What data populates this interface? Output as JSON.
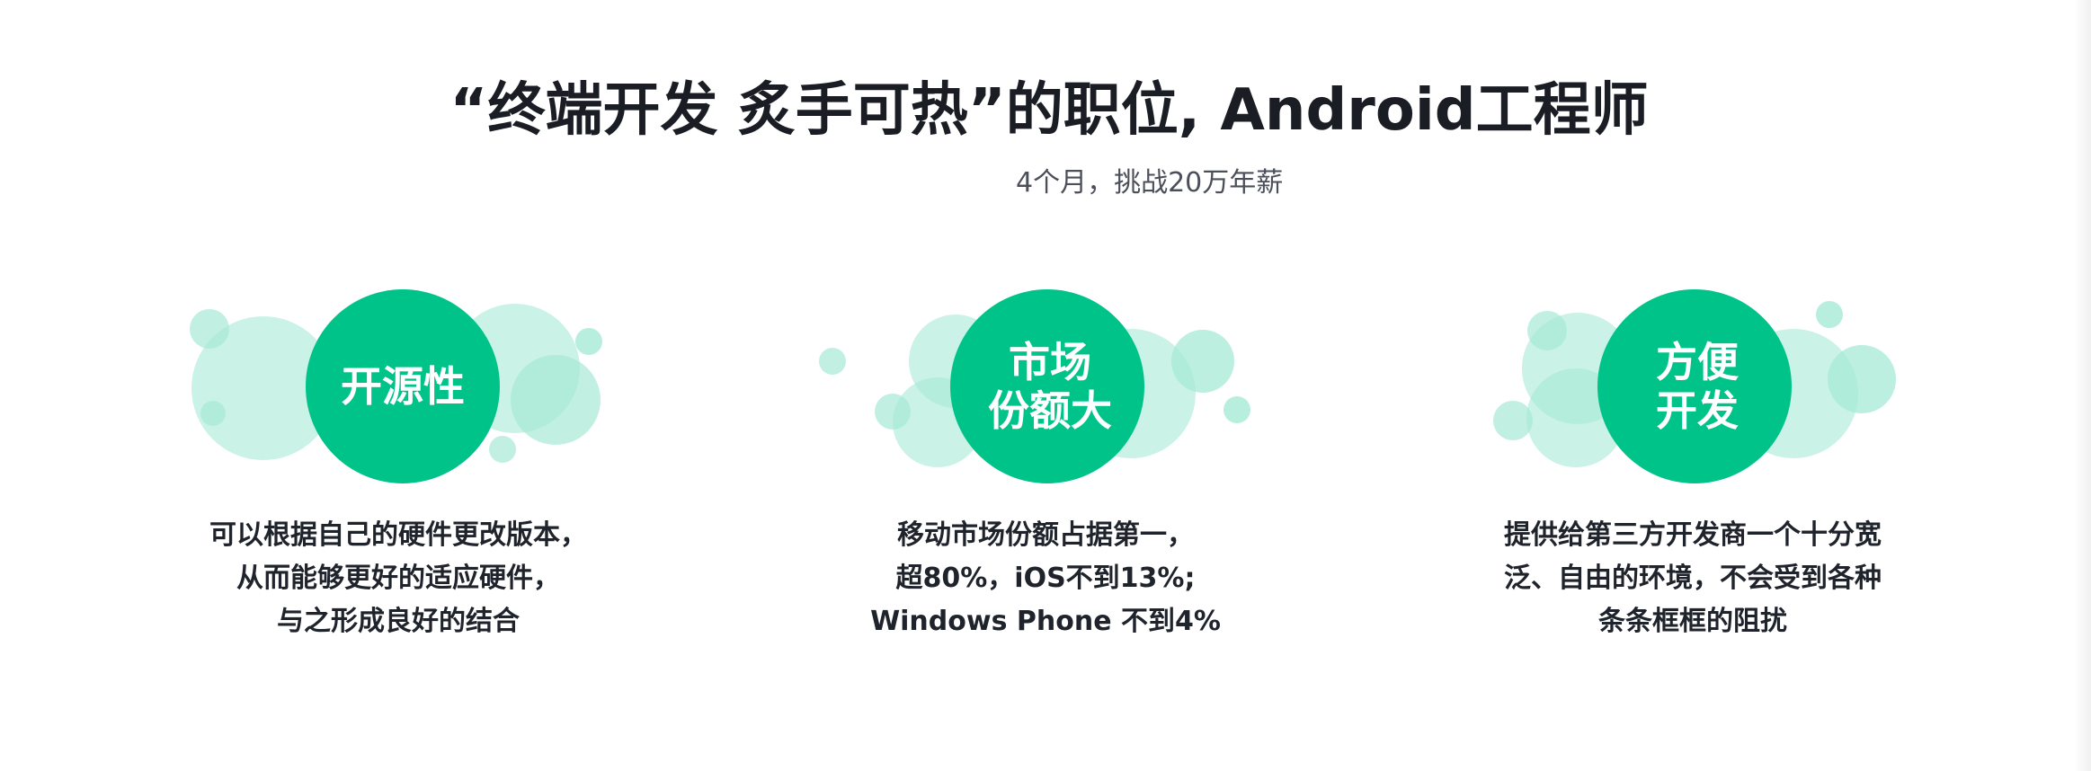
{
  "hero": {
    "title": "“终端开发 炙手可热”的职位, Android工程师",
    "subtitle": "4个月，挑战20万年薪"
  },
  "colors": {
    "brand_green": "#00c38a",
    "bubble_green": "#a6ead5",
    "text_dark": "#1a1d24",
    "text_gray": "#4a4f59"
  },
  "features": [
    {
      "label": "开源性",
      "desc_lines": [
        "可以根据自己的硬件更改版本，",
        "从而能够更好的适应硬件，",
        "与之形成良好的结合"
      ]
    },
    {
      "label": "市场\n份额大",
      "desc_lines": [
        "移动市场份额占据第一，",
        "超80%，iOS不到13%;",
        "Windows Phone 不到4%"
      ]
    },
    {
      "label": "方便\n开发",
      "desc_lines": [
        "提供给第三方开发商一个十分宽",
        "泛、自由的环境，不会受到各种",
        "条条框框的阻扰"
      ]
    }
  ]
}
